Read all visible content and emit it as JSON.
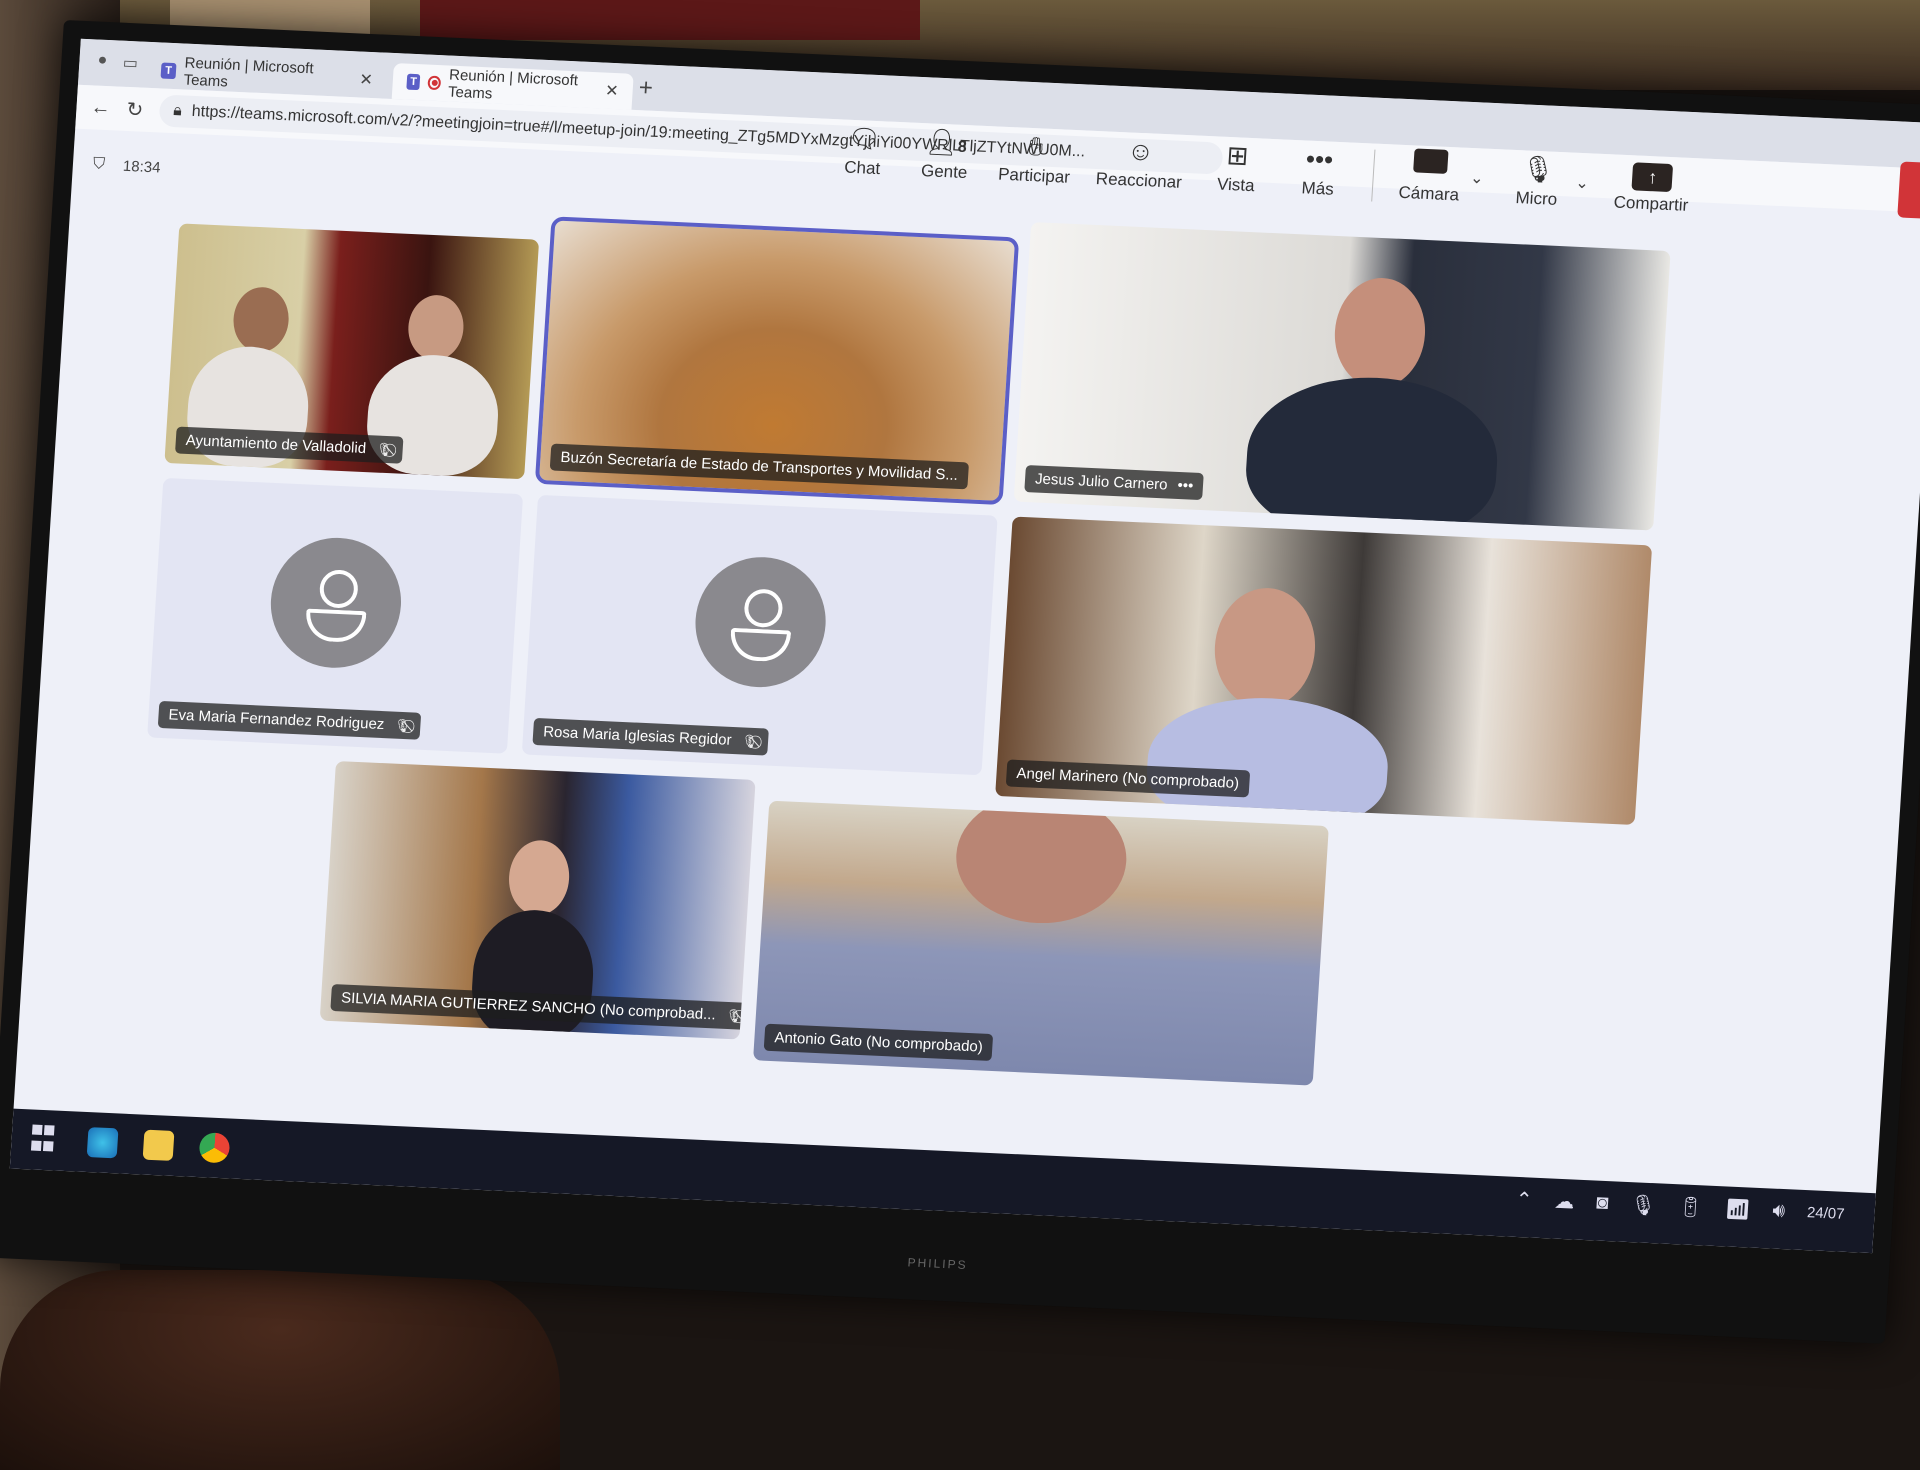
{
  "browser": {
    "tabs": [
      {
        "title": "Reunión | Microsoft Teams",
        "active": false
      },
      {
        "title": "Reunión | Microsoft Teams",
        "active": true,
        "recording": true
      }
    ],
    "new_tab_icon": "plus-icon",
    "url": "https://teams.microsoft.com/v2/?meetingjoin=true#/l/meetup-join/19:meeting_ZTg5MDYxMzgtYjhiYi00YWRlLTljZTYtNWU0M..."
  },
  "meeting": {
    "elapsed_time": "18:34",
    "toolbar": {
      "chat": "Chat",
      "people": "Gente",
      "people_count": "8",
      "raise_hand": "Participar",
      "react": "Reaccionar",
      "view": "Vista",
      "more": "Más",
      "camera": "Cámara",
      "mic": "Micro",
      "share": "Compartir"
    },
    "participants": [
      {
        "name": "Ayuntamiento de Valladolid",
        "muted": true,
        "video": true
      },
      {
        "name": "Buzón Secretaría de Estado de Transportes y Movilidad S...",
        "muted": false,
        "video": true,
        "spotlight": true
      },
      {
        "name": "Jesus Julio Carnero",
        "muted": false,
        "video": true,
        "more_options": "•••"
      },
      {
        "name": "Eva Maria Fernandez Rodriguez",
        "muted": true,
        "video": false
      },
      {
        "name": "Rosa Maria Iglesias Regidor",
        "muted": true,
        "video": false
      },
      {
        "name": "Angel Marinero (No comprobado)",
        "muted": false,
        "video": true
      },
      {
        "name": "SILVIA MARIA GUTIERREZ SANCHO (No comprobad...",
        "muted": true,
        "video": true
      },
      {
        "name": "Antonio Gato (No comprobado)",
        "muted": false,
        "video": true
      }
    ]
  },
  "taskbar": {
    "apps": [
      "start",
      "edge",
      "file-explorer",
      "chrome"
    ],
    "clock_date": "24/07"
  },
  "monitor_brand": "PHILIPS"
}
